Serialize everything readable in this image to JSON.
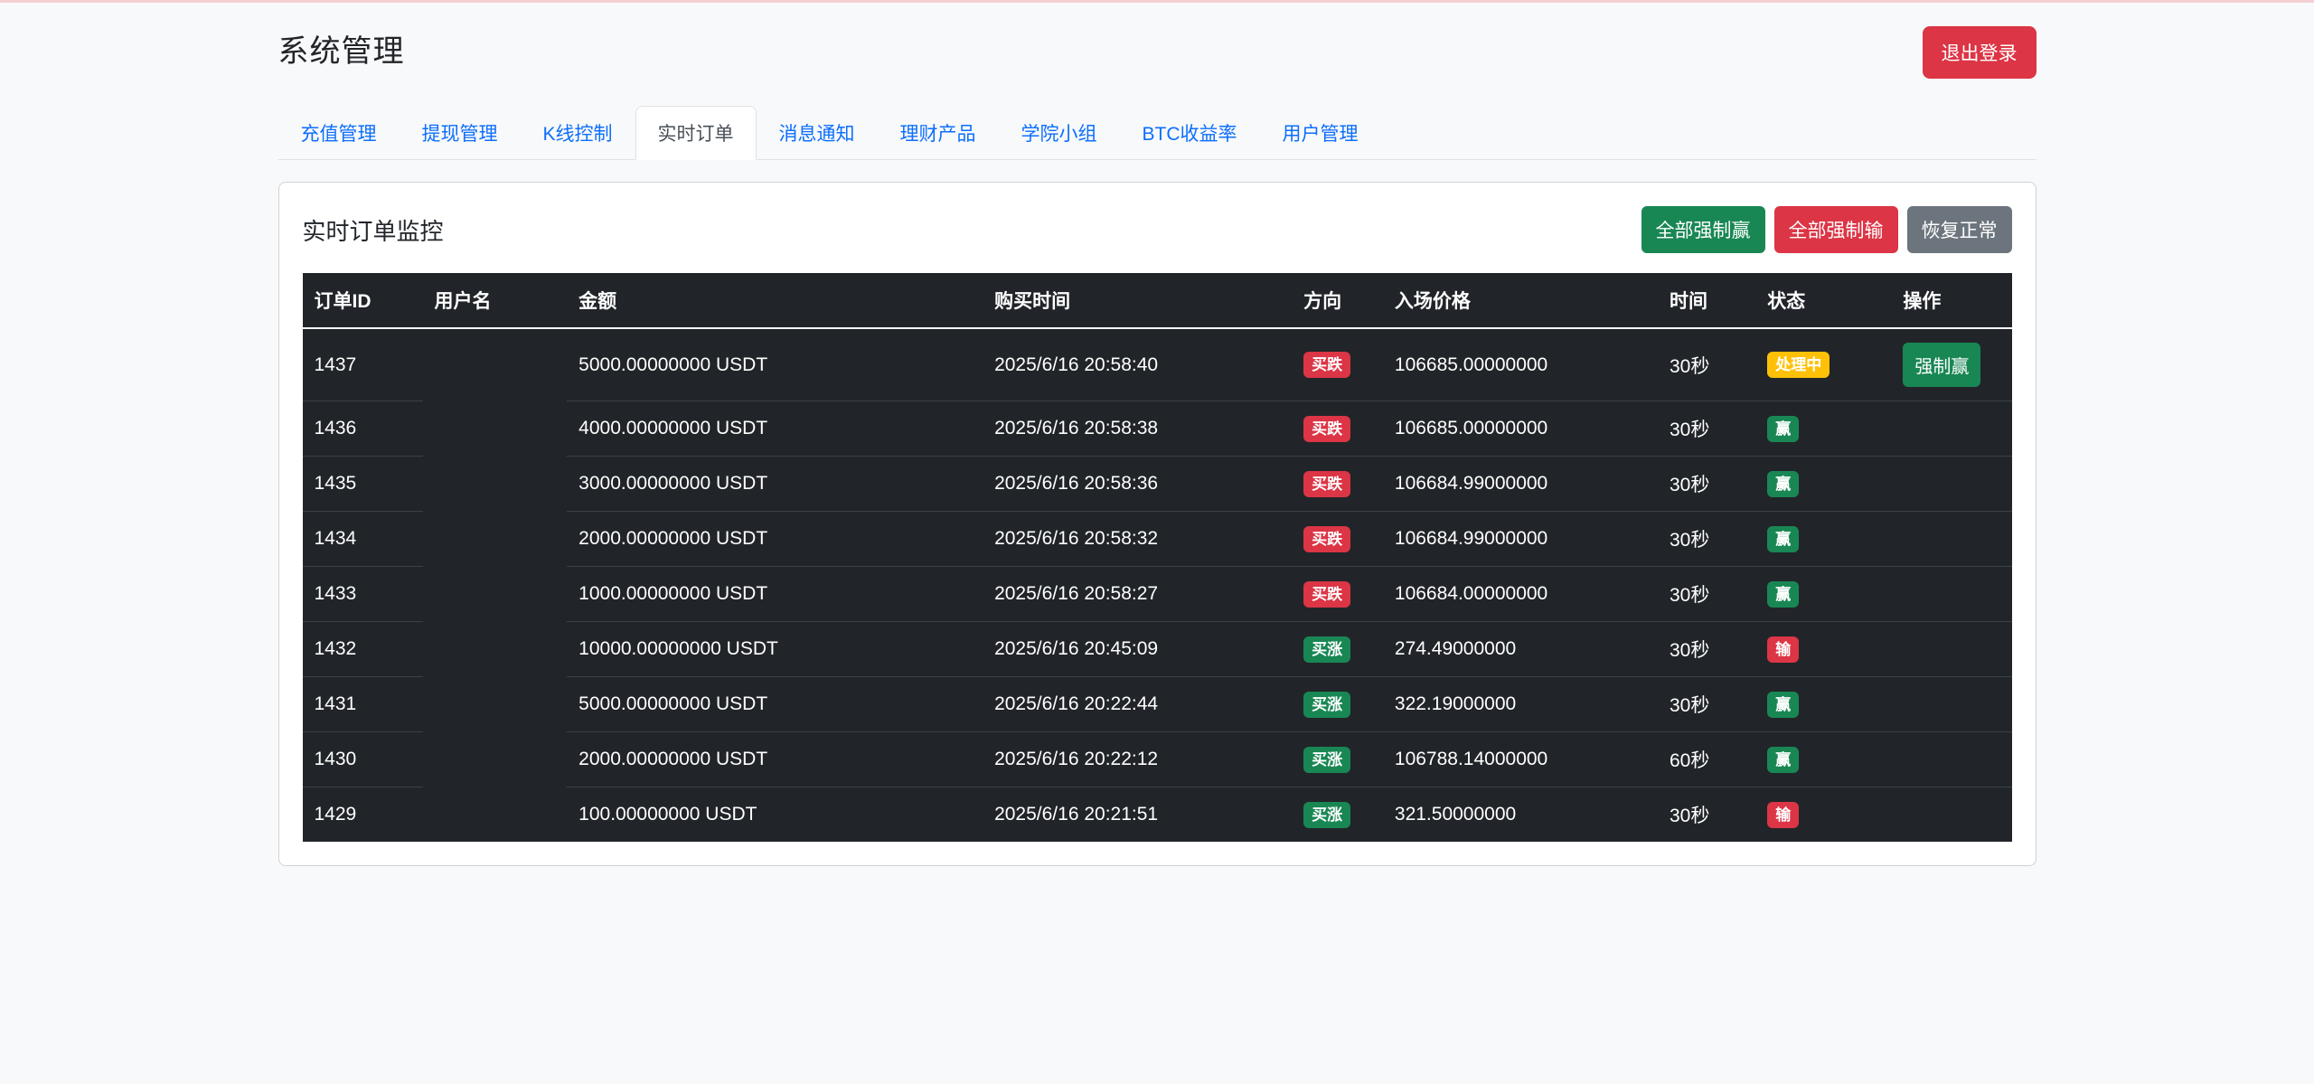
{
  "page": {
    "title": "系统管理",
    "logout_label": "退出登录"
  },
  "tabs": [
    {
      "label": "充值管理",
      "active": false
    },
    {
      "label": "提现管理",
      "active": false
    },
    {
      "label": "K线控制",
      "active": false
    },
    {
      "label": "实时订单",
      "active": true
    },
    {
      "label": "消息通知",
      "active": false
    },
    {
      "label": "理财产品",
      "active": false
    },
    {
      "label": "学院小组",
      "active": false
    },
    {
      "label": "BTC收益率",
      "active": false
    },
    {
      "label": "用户管理",
      "active": false
    }
  ],
  "panel": {
    "title": "实时订单监控",
    "force_win_all_label": "全部强制赢",
    "force_lose_all_label": "全部强制输",
    "restore_normal_label": "恢复正常"
  },
  "badge_colors": {
    "买跌": "#dc3545",
    "买涨": "#198754",
    "处理中": "#ffc107",
    "赢": "#198754",
    "输": "#dc3545"
  },
  "table": {
    "headers": [
      "订单ID",
      "用户名",
      "金额",
      "购买时间",
      "方向",
      "入场价格",
      "时间",
      "状态",
      "操作"
    ],
    "rows": [
      {
        "id": "1437",
        "username": "",
        "amount": "5000.00000000 USDT",
        "buy_time": "2025/6/16 20:58:40",
        "direction": "买跌",
        "entry_price": "106685.00000000",
        "duration": "30秒",
        "status": "处理中",
        "action": "强制赢"
      },
      {
        "id": "1436",
        "username": "",
        "amount": "4000.00000000 USDT",
        "buy_time": "2025/6/16 20:58:38",
        "direction": "买跌",
        "entry_price": "106685.00000000",
        "duration": "30秒",
        "status": "赢",
        "action": ""
      },
      {
        "id": "1435",
        "username": "",
        "amount": "3000.00000000 USDT",
        "buy_time": "2025/6/16 20:58:36",
        "direction": "买跌",
        "entry_price": "106684.99000000",
        "duration": "30秒",
        "status": "赢",
        "action": ""
      },
      {
        "id": "1434",
        "username": "",
        "amount": "2000.00000000 USDT",
        "buy_time": "2025/6/16 20:58:32",
        "direction": "买跌",
        "entry_price": "106684.99000000",
        "duration": "30秒",
        "status": "赢",
        "action": ""
      },
      {
        "id": "1433",
        "username": "",
        "amount": "1000.00000000 USDT",
        "buy_time": "2025/6/16 20:58:27",
        "direction": "买跌",
        "entry_price": "106684.00000000",
        "duration": "30秒",
        "status": "赢",
        "action": ""
      },
      {
        "id": "1432",
        "username": "",
        "amount": "10000.00000000 USDT",
        "buy_time": "2025/6/16 20:45:09",
        "direction": "买涨",
        "entry_price": "274.49000000",
        "duration": "30秒",
        "status": "输",
        "action": ""
      },
      {
        "id": "1431",
        "username": "",
        "amount": "5000.00000000 USDT",
        "buy_time": "2025/6/16 20:22:44",
        "direction": "买涨",
        "entry_price": "322.19000000",
        "duration": "30秒",
        "status": "赢",
        "action": ""
      },
      {
        "id": "1430",
        "username": "",
        "amount": "2000.00000000 USDT",
        "buy_time": "2025/6/16 20:22:12",
        "direction": "买涨",
        "entry_price": "106788.14000000",
        "duration": "60秒",
        "status": "赢",
        "action": ""
      },
      {
        "id": "1429",
        "username": "",
        "amount": "100.00000000 USDT",
        "buy_time": "2025/6/16 20:21:51",
        "direction": "买涨",
        "entry_price": "321.50000000",
        "duration": "30秒",
        "status": "输",
        "action": ""
      }
    ]
  }
}
